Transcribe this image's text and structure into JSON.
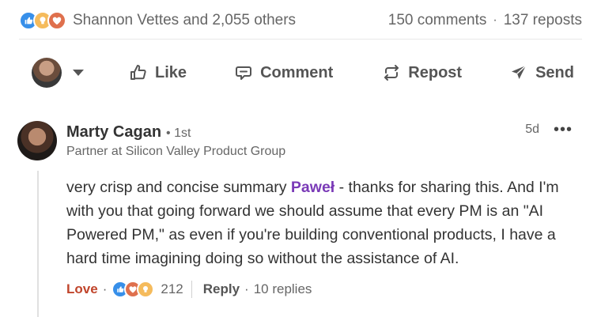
{
  "social": {
    "reactors_text": "Shannon Vettes and 2,055 others",
    "comments_text": "150 comments",
    "dot": "·",
    "reposts_text": "137 reposts",
    "reaction_icons": [
      "like-icon",
      "insightful-icon",
      "love-icon"
    ]
  },
  "actions": {
    "like": "Like",
    "comment": "Comment",
    "repost": "Repost",
    "send": "Send"
  },
  "comment": {
    "author": "Marty Cagan",
    "degree": "• 1st",
    "headline": "Partner at Silicon Valley Product Group",
    "time": "5d",
    "menu": "•••",
    "text_before": "very crisp and concise summary ",
    "mention": "Paweł",
    "text_after": " - thanks for sharing this. And I'm with you that going forward we should assume that every PM is an \"AI Powered PM,\" as even if you're building conventional products, I have a hard time imagining doing so without the assistance of AI.",
    "reaction_label": "Love",
    "dot": "·",
    "reaction_count": "212",
    "reply_label": "Reply",
    "replies": "10 replies",
    "reaction_icons": [
      "like-icon",
      "love-icon",
      "insightful-icon"
    ]
  },
  "colors": {
    "like": "#378fe9",
    "love": "#df704d",
    "insightful": "#f5bb5c",
    "mention": "#7a3ab7"
  }
}
